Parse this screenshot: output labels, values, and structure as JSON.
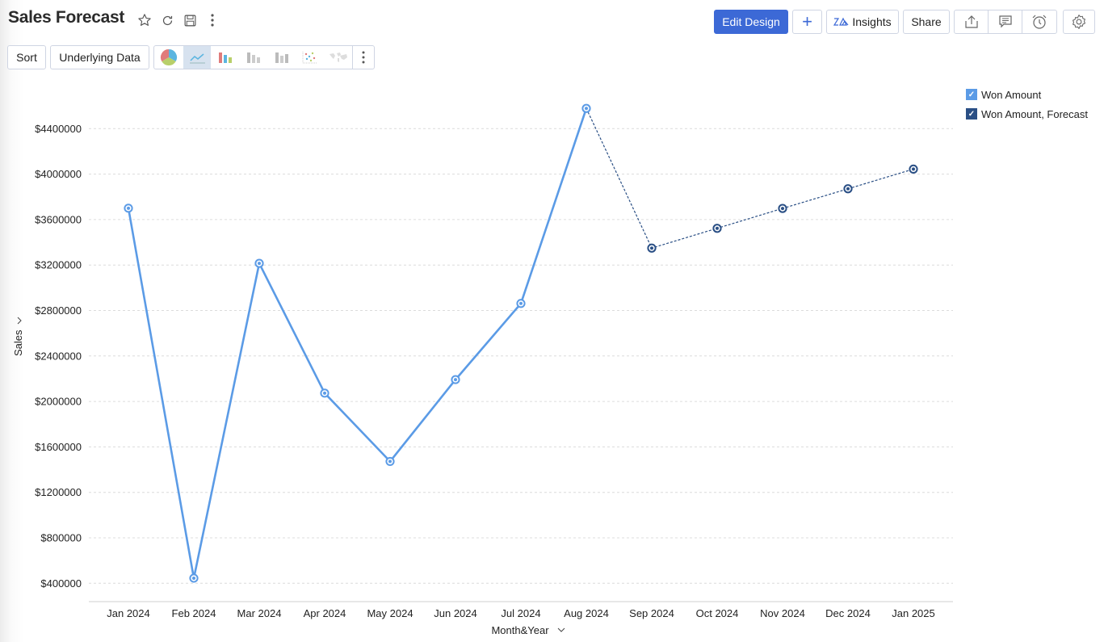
{
  "header": {
    "title": "Sales Forecast",
    "title_icons": [
      "star-icon",
      "refresh-icon",
      "save-icon",
      "more-vertical-icon"
    ]
  },
  "toolbar": {
    "sort_label": "Sort",
    "underlying_label": "Underlying Data",
    "chart_types": [
      "pie",
      "line",
      "bar",
      "stacked-bar",
      "waterfall",
      "scatter",
      "map"
    ],
    "active_chart_type": "line",
    "edit_design_label": "Edit Design",
    "add_label": "+",
    "insights_label": "Insights",
    "share_label": "Share",
    "icons": [
      "export-icon",
      "comment-icon",
      "alarm-icon",
      "settings-icon"
    ]
  },
  "colors": {
    "actual": "#5b9be6",
    "forecast": "#2a4f85",
    "primary_button": "#3c69d6"
  },
  "chart_data": {
    "type": "line",
    "title": "Sales Forecast",
    "xlabel": "Month&Year",
    "ylabel": "Sales",
    "ylim": [
      200000,
      4700000
    ],
    "yticks": [
      400000,
      800000,
      1200000,
      1600000,
      2000000,
      2400000,
      2800000,
      3200000,
      3600000,
      4000000,
      4400000
    ],
    "ytick_labels": [
      "$400000",
      "$800000",
      "$1200000",
      "$1600000",
      "$2000000",
      "$2400000",
      "$2800000",
      "$3200000",
      "$3600000",
      "$4000000",
      "$4400000"
    ],
    "grid": true,
    "legend_position": "top-right",
    "categories": [
      "Jan 2024",
      "Feb 2024",
      "Mar 2024",
      "Apr 2024",
      "May 2024",
      "Jun 2024",
      "Jul 2024",
      "Aug 2024",
      "Sep 2024",
      "Oct 2024",
      "Nov 2024",
      "Dec 2024",
      "Jan 2025"
    ],
    "series": [
      {
        "name": "Won Amount",
        "style": "solid",
        "values": [
          3700000,
          445000,
          3215000,
          2073000,
          1472000,
          2192000,
          2862000,
          4578000,
          null,
          null,
          null,
          null,
          null
        ]
      },
      {
        "name": "Won Amount, Forecast",
        "style": "dotted",
        "values": [
          null,
          null,
          null,
          null,
          null,
          null,
          null,
          4578000,
          3349000,
          3523000,
          3698000,
          3871000,
          4044000
        ]
      }
    ]
  }
}
